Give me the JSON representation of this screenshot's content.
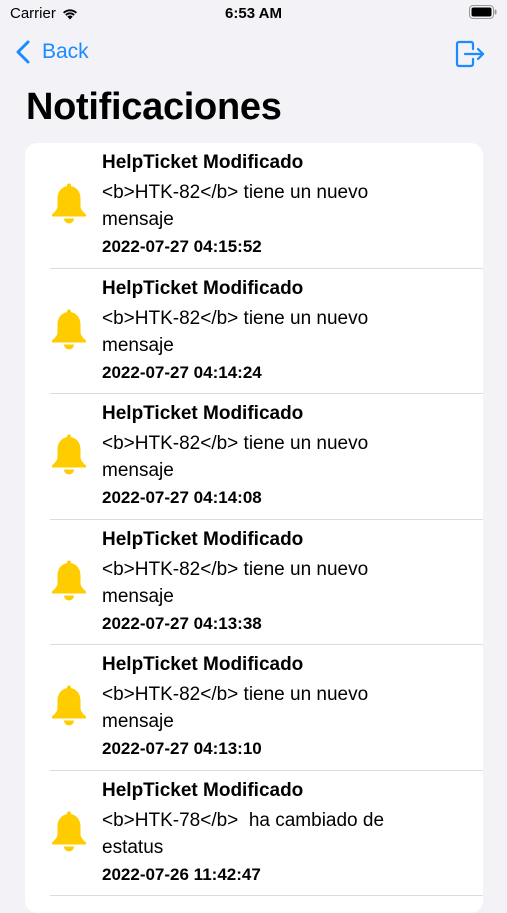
{
  "status_bar": {
    "carrier": "Carrier",
    "time": "6:53 AM"
  },
  "nav": {
    "back_label": "Back",
    "accent_color": "#1a8cff"
  },
  "title": "Notificaciones",
  "notifications": [
    {
      "title": "HelpTicket Modificado",
      "message": "<b>HTK-82</b> tiene un nuevo mensaje",
      "date": "2022-07-27 04:15:52",
      "icon": "bell-icon"
    },
    {
      "title": "HelpTicket Modificado",
      "message": "<b>HTK-82</b> tiene un nuevo mensaje",
      "date": "2022-07-27 04:14:24",
      "icon": "bell-icon"
    },
    {
      "title": "HelpTicket Modificado",
      "message": "<b>HTK-82</b> tiene un nuevo mensaje",
      "date": "2022-07-27 04:14:08",
      "icon": "bell-icon"
    },
    {
      "title": "HelpTicket Modificado",
      "message": "<b>HTK-82</b> tiene un nuevo mensaje",
      "date": "2022-07-27 04:13:38",
      "icon": "bell-icon"
    },
    {
      "title": "HelpTicket Modificado",
      "message": "<b>HTK-82</b> tiene un nuevo mensaje",
      "date": "2022-07-27 04:13:10",
      "icon": "bell-icon"
    },
    {
      "title": "HelpTicket Modificado",
      "message": "<b>HTK-78</b>  ha cambiado de estatus",
      "date": "2022-07-26 11:42:47",
      "icon": "bell-icon"
    }
  ],
  "colors": {
    "bell": "#ffcc00",
    "background": "#f2f2f7"
  }
}
